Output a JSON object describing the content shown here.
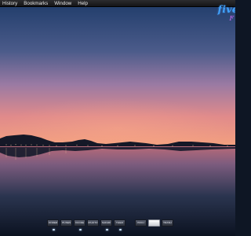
{
  "menubar": {
    "items": [
      {
        "label": "History"
      },
      {
        "label": "Bookmarks"
      },
      {
        "label": "Window"
      },
      {
        "label": "Help"
      }
    ]
  },
  "logo": {
    "main": "five",
    "sub": "F"
  },
  "dock": {
    "items": [
      {
        "label": "FINDER"
      },
      {
        "label": "ITUNES"
      },
      {
        "label": "XCODE"
      },
      {
        "label": "IPHOTO"
      },
      {
        "label": "SAFARI"
      },
      {
        "label": "THEM"
      },
      {
        "label": "PROJ"
      },
      {
        "label": ""
      },
      {
        "label": "TRASH"
      }
    ]
  },
  "colors": {
    "menubar": "#1e1e20",
    "logo_main": "#3fa3ff",
    "logo_sub": "#d46bff",
    "sky_top": "#1f3a66",
    "horizon": "#f08a78",
    "water": "#0e1624"
  },
  "icons": [
    "finder-icon",
    "itunes-icon",
    "xcode-icon",
    "iphoto-icon",
    "safari-icon",
    "theme-icon",
    "project-icon",
    "blank-icon",
    "trash-icon"
  ]
}
